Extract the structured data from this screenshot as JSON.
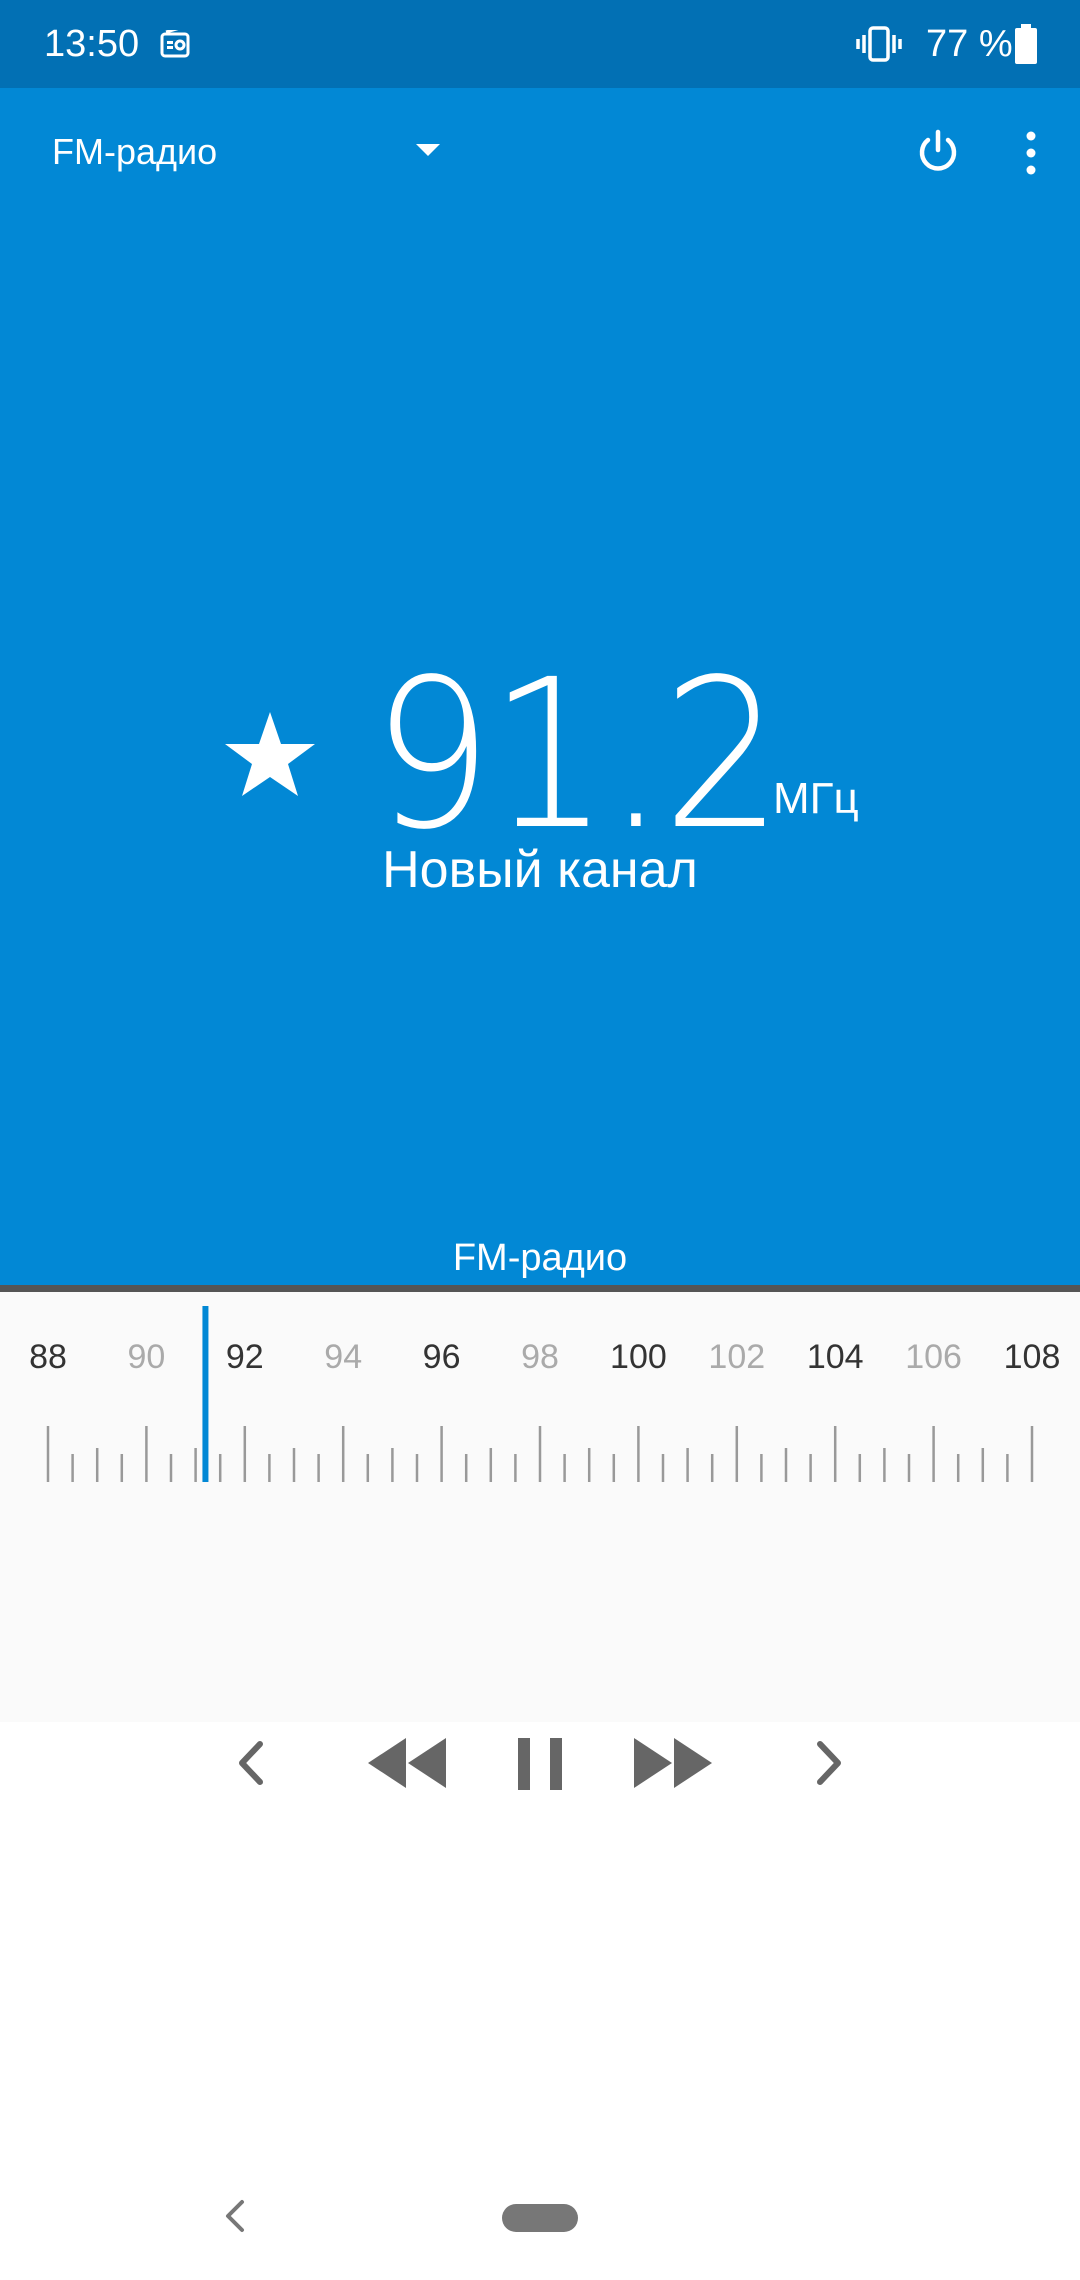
{
  "status_bar": {
    "time": "13:50",
    "battery": "77 %",
    "icons": [
      "radio-icon",
      "vibrate-icon",
      "battery-icon"
    ]
  },
  "header": {
    "title": "FM-радио",
    "icons": [
      "dropdown-icon",
      "power-icon",
      "more-vert-icon"
    ]
  },
  "station": {
    "frequency": "91.2",
    "unit": "МГц",
    "name": "Новый канал",
    "favorite": true
  },
  "band_label": "FM-радио",
  "tuner": {
    "labels": [
      "88",
      "90",
      "92",
      "94",
      "96",
      "98",
      "100",
      "102",
      "104",
      "106",
      "108"
    ],
    "min": 88,
    "max": 108,
    "current": 91.2
  },
  "controls": [
    "prev-icon",
    "rewind-icon",
    "pause-icon",
    "fast-forward-icon",
    "next-icon"
  ],
  "colors": {
    "status_bar": "#0270B4",
    "app_bg": "#0288D5",
    "tuner_bg": "#FAFAFA",
    "indicator": "#0288D5"
  }
}
